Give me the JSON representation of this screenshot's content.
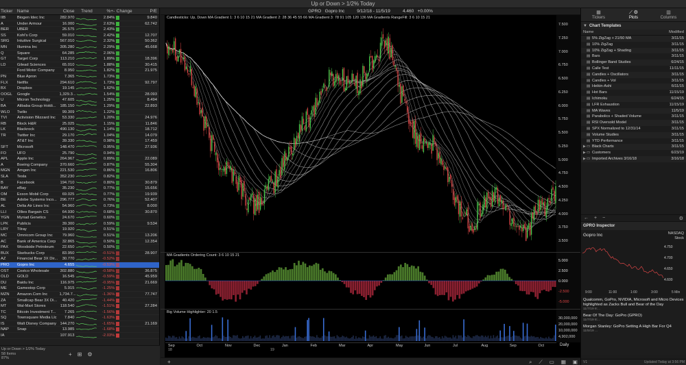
{
  "window": {
    "title": "Up or Down > 1/2% Today"
  },
  "watchlist": {
    "columns": {
      "ticker": "Ticker",
      "name": "Name",
      "close": "Close",
      "trend": "Trend",
      "pct": "%+-",
      "change": "Change",
      "pe": "P/E"
    },
    "rows": [
      {
        "ticker": "IIB",
        "name": "Biogen Idec Inc",
        "close": "282.970",
        "pct": "2.84%",
        "pe": "9.840",
        "dir": "up",
        "mag": 0.9
      },
      {
        "ticker": "A",
        "name": "Under Armour",
        "close": "16.000",
        "pct": "2.63%",
        "pe": "62.742",
        "dir": "up",
        "mag": 0.85
      },
      {
        "ticker": "BER",
        "name": "UBER",
        "close": "26.575",
        "pct": "2.43%",
        "pe": "",
        "dir": "up",
        "mag": 0.8
      },
      {
        "ticker": "SS",
        "name": "Kohl's Corp",
        "close": "59.010",
        "pct": "2.42%",
        "pe": "12.707",
        "dir": "up",
        "mag": 0.8
      },
      {
        "ticker": "SRG",
        "name": "Intuitive Surgical",
        "close": "567.010",
        "pct": "2.32%",
        "pe": "50.362",
        "dir": "up",
        "mag": 0.75
      },
      {
        "ticker": "MN",
        "name": "Illumina Inc",
        "close": "305.280",
        "pct": "2.29%",
        "pe": "45.668",
        "dir": "up",
        "mag": 0.75
      },
      {
        "ticker": "Q",
        "name": "Square",
        "close": "64.285",
        "pct": "2.06%",
        "pe": "",
        "dir": "up",
        "mag": 0.7
      },
      {
        "ticker": "GT",
        "name": "Target Corp",
        "close": "113.210",
        "pct": "1.89%",
        "pe": "18.396",
        "dir": "up",
        "mag": 0.65
      },
      {
        "ticker": "LD",
        "name": "Gilead Sciences",
        "close": "65.010",
        "pct": "1.88%",
        "pe": "30.415",
        "dir": "up",
        "mag": 0.65
      },
      {
        "ticker": "",
        "name": "Ford Motor Company",
        "close": "8.950",
        "pct": "1.82%",
        "pe": "21.975",
        "dir": "up",
        "mag": 0.6
      },
      {
        "ticker": "PN",
        "name": "Blue Apron",
        "close": "7.365",
        "pct": "1.73%",
        "pe": "",
        "dir": "up",
        "mag": 0.6
      },
      {
        "ticker": "FLX",
        "name": "Netflix",
        "close": "294.610",
        "pct": "1.73%",
        "pe": "92.797",
        "dir": "up",
        "mag": 0.6
      },
      {
        "ticker": "BX",
        "name": "Dropbox",
        "close": "19.145",
        "pct": "1.62%",
        "pe": "",
        "dir": "up",
        "mag": 0.55
      },
      {
        "ticker": "OOGL",
        "name": "Google",
        "close": "1,329.3...",
        "pct": "1.54%",
        "pe": "28.093",
        "dir": "up",
        "mag": 0.55
      },
      {
        "ticker": "U",
        "name": "Micron Technology",
        "close": "47.605",
        "pct": "1.25%",
        "pe": "8.494",
        "dir": "up",
        "mag": 0.45
      },
      {
        "ticker": "BA",
        "name": "Alibaba Group Holdi...",
        "close": "185.150",
        "pct": "1.29%",
        "pe": "22.893",
        "dir": "up",
        "mag": 0.45
      },
      {
        "ticker": "WLO",
        "name": "Twilio",
        "close": "99.309",
        "pct": "1.22%",
        "pe": "",
        "dir": "up",
        "mag": 0.45
      },
      {
        "ticker": "TVI",
        "name": "Activision Blizzard Inc",
        "close": "53.330",
        "pct": "1.20%",
        "pe": "24.976",
        "dir": "up",
        "mag": 0.4
      },
      {
        "ticker": "RB",
        "name": "Block H&R",
        "close": "25.025",
        "pct": "1.15%",
        "pe": "11.846",
        "dir": "up",
        "mag": 0.4
      },
      {
        "ticker": "LK",
        "name": "Blackrock",
        "close": "490.130",
        "pct": "1.14%",
        "pe": "18.712",
        "dir": "up",
        "mag": 0.4
      },
      {
        "ticker": "TR",
        "name": "Twitter Inc",
        "close": "29.170",
        "pct": "1.04%",
        "pe": "14.079",
        "dir": "up",
        "mag": 0.35
      },
      {
        "ticker": "",
        "name": "AT&T Inc",
        "close": "39.330",
        "pct": "0.98%",
        "pe": "17.459",
        "dir": "up",
        "mag": 0.35
      },
      {
        "ticker": "SFT",
        "name": "Microsoft",
        "close": "148.470",
        "pct": "0.95%",
        "pe": "27.936",
        "dir": "up",
        "mag": 0.3
      },
      {
        "ticker": "FO",
        "name": "UFO",
        "close": "25.790",
        "pct": "0.94%",
        "pe": "",
        "dir": "up",
        "mag": 0.3
      },
      {
        "ticker": "APL",
        "name": "Apple Inc",
        "close": "264.967",
        "pct": "0.89%",
        "pe": "22.089",
        "dir": "up",
        "mag": 0.3
      },
      {
        "ticker": "A",
        "name": "Boeing Company",
        "close": "370.660",
        "pct": "0.87%",
        "pe": "55.304",
        "dir": "up",
        "mag": 0.3
      },
      {
        "ticker": "MGN",
        "name": "Amgen Inc",
        "close": "221.530",
        "pct": "0.86%",
        "pe": "16.806",
        "dir": "up",
        "mag": 0.3
      },
      {
        "ticker": "SLA",
        "name": "Tesla",
        "close": "352.230",
        "pct": "0.82%",
        "pe": "",
        "dir": "up",
        "mag": 0.3
      },
      {
        "ticker": "B",
        "name": "Facebook",
        "close": "194.710",
        "pct": "0.80%",
        "pe": "30.879",
        "dir": "up",
        "mag": 0.3
      },
      {
        "ticker": "BAY",
        "name": "eBay",
        "close": "35.230",
        "pct": "0.77%",
        "pe": "15.656",
        "dir": "up",
        "mag": 0.25
      },
      {
        "ticker": "OM",
        "name": "Exxon Mobil Corp",
        "close": "69.025",
        "pct": "0.77%",
        "pe": "19.939",
        "dir": "up",
        "mag": 0.25
      },
      {
        "ticker": "BE",
        "name": "Adobe Systems Inco...",
        "close": "296.777",
        "pct": "0.76%",
        "pe": "52.407",
        "dir": "up",
        "mag": 0.25
      },
      {
        "ticker": "AL",
        "name": "Delta Air Lines Inc",
        "close": "54.960",
        "pct": "0.73%",
        "pe": "8.000",
        "dir": "up",
        "mag": 0.25
      },
      {
        "ticker": "LLI",
        "name": "Ollies Bargain CS",
        "close": "64.930",
        "pct": "0.68%",
        "pe": "30.870",
        "dir": "up",
        "mag": 0.2
      },
      {
        "ticker": "YGN",
        "name": "Myriad Genetics",
        "close": "24.670",
        "pct": "0.60%",
        "pe": "",
        "dir": "up",
        "mag": 0.2
      },
      {
        "ticker": "LPK",
        "name": "Publicis",
        "close": "39.300",
        "pct": "0.59%",
        "pe": "9.534",
        "dir": "up",
        "mag": 0.2
      },
      {
        "ticker": "LRY",
        "name": "Tilray",
        "close": "19.920",
        "pct": "0.51%",
        "pe": "",
        "dir": "up",
        "mag": 0.2
      },
      {
        "ticker": "MC",
        "name": "Omnicom Group Inc",
        "close": "79.960",
        "pct": "0.51%",
        "pe": "13.206",
        "dir": "up",
        "mag": 0.2
      },
      {
        "ticker": "AC",
        "name": "Bank of America Corp",
        "close": "32.865",
        "pct": "0.50%",
        "pe": "12.354",
        "dir": "up",
        "mag": 0.2
      },
      {
        "ticker": "PAX",
        "name": "Woodside Petroleum",
        "close": "22.650",
        "pct": "0.50%",
        "pe": "",
        "dir": "up",
        "mag": 0.2
      },
      {
        "ticker": "BUX",
        "name": "Starbucks Corp",
        "close": "83.950",
        "pct": "-0.51%",
        "pe": "28.907",
        "dir": "down",
        "mag": 0.2
      },
      {
        "ticker": "AZ",
        "name": "Financial Bear 3X Dir...",
        "close": "30.770",
        "pct": "-0.52%",
        "pe": "",
        "dir": "down",
        "mag": 0.2
      },
      {
        "ticker": "PRO",
        "name": "Gopro Inc",
        "close": "4.655",
        "pct": "-0.53%",
        "pe": "",
        "dir": "down",
        "mag": 0.2,
        "selected": true
      },
      {
        "ticker": "OST",
        "name": "Costco Wholesale",
        "close": "302.880",
        "pct": "-0.58%",
        "pe": "36.875",
        "dir": "down",
        "mag": 0.2
      },
      {
        "ticker": "OLD",
        "name": "GOLD",
        "close": "16.545",
        "pct": "-0.59%",
        "pe": "45.959",
        "dir": "down",
        "mag": 0.2
      },
      {
        "ticker": "DU",
        "name": "Baidu Inc",
        "close": "116.975",
        "pct": "-0.95%",
        "pe": "21.669",
        "dir": "down",
        "mag": 0.3
      },
      {
        "ticker": "ME",
        "name": "Gamestop Corp",
        "close": "5.915",
        "pct": "-1.25%",
        "pe": "",
        "dir": "down",
        "mag": 0.45
      },
      {
        "ticker": "MZN",
        "name": "Amazon.Com Inc",
        "close": "1,734.7...",
        "pct": "-1.36%",
        "pe": "77.747",
        "dir": "down",
        "mag": 0.5
      },
      {
        "ticker": "ZA",
        "name": "Smallcap Bear 3X Di...",
        "close": "40.420",
        "pct": "-1.44%",
        "pe": "",
        "dir": "down",
        "mag": 0.5
      },
      {
        "ticker": "MT",
        "name": "Wal-Mart Stores",
        "close": "118.540",
        "pct": "-1.51%",
        "pe": "27.284",
        "dir": "down",
        "mag": 0.55
      },
      {
        "ticker": "TC",
        "name": "Bitcoin Investment T...",
        "close": "7.265",
        "pct": "-1.56%",
        "pe": "",
        "dir": "down",
        "mag": 0.55
      },
      {
        "ticker": "SQ",
        "name": "Townsquare Media Llc",
        "close": "7.840",
        "pct": "-1.63%",
        "pe": "",
        "dir": "down",
        "mag": 0.6
      },
      {
        "ticker": "IS",
        "name": "Walt Disney Company",
        "close": "144.270",
        "pct": "-1.65%",
        "pe": "21.169",
        "dir": "down",
        "mag": 0.6
      },
      {
        "ticker": "NAP",
        "name": "Snap",
        "close": "13.985",
        "pct": "-1.68%",
        "pe": "",
        "dir": "down",
        "mag": 0.6
      },
      {
        "ticker": "IA",
        "name": "",
        "close": "107.913",
        "pct": "-2.03%",
        "pe": "",
        "dir": "down",
        "mag": 0.7
      }
    ],
    "footer": {
      "line1": "Up or Down > 1/2% Today",
      "line2": "58 Items",
      "line3": "87%"
    }
  },
  "chart": {
    "header": "GPRO   Gopro Inc          9/12/18 - 11/5/19          4.460   +0.00%",
    "price_pane_label": "Candlesticks: Up, Down    MA Gradient 1: 3 6 10 15 21    MA Gradient 2: 28 36 45 55 66    MA Gradient 3: 78 91 105 120 136    MA Gradients RangeFill: 3 6 10 15 21",
    "ordering_label": "MA Gradients Ordering Count:  3 6 10 15 21",
    "volume_label": "Big Volume Highlighter:  20 1.5",
    "period": "Daily",
    "x_months": [
      "Sep",
      "Oct",
      "Nov",
      "Dec",
      "Jan",
      "Feb",
      "Mar",
      "Apr",
      "May",
      "Jun",
      "Jul",
      "Aug",
      "Sep",
      "Oct"
    ],
    "x_years": [
      "18",
      "19"
    ],
    "price_ticks": [
      "7.500",
      "7.250",
      "7.000",
      "6.750",
      "6.500",
      "6.250",
      "6.000",
      "5.750",
      "5.500",
      "5.250",
      "5.000",
      "4.750",
      "4.500",
      "4.250",
      "4.000",
      "3.750",
      "3.500"
    ],
    "right_values": [
      "5.082",
      "4.913",
      "4.736",
      "4.596",
      "4.488",
      "4.162",
      "3.871",
      "3.676"
    ],
    "ordering_ticks": [
      "5.000",
      "2.500",
      "0.000",
      "-2.500",
      "-5.000"
    ],
    "ordering_right": [
      "-1.000"
    ],
    "volume_ticks": [
      "30,000,000",
      "20,000,000",
      "10,000,000",
      "4,902,000"
    ]
  },
  "chart_data": {
    "type": "candlestick",
    "title": "GPRO Gopro Inc",
    "x_range": [
      "9/12/18",
      "11/5/19"
    ],
    "ylim": [
      3.5,
      7.5
    ],
    "last": 4.46,
    "change_pct": 0.0,
    "approx_close_path": [
      {
        "month": "Sep 18",
        "close": 7.2
      },
      {
        "month": "Oct 18",
        "close": 6.4
      },
      {
        "month": "Nov 18",
        "close": 4.8
      },
      {
        "month": "Dec 18",
        "close": 4.3
      },
      {
        "month": "Jan 19",
        "close": 4.5
      },
      {
        "month": "Feb 19",
        "close": 5.9
      },
      {
        "month": "Mar 19",
        "close": 6.4
      },
      {
        "month": "Apr 19",
        "close": 6.6
      },
      {
        "month": "May 19",
        "close": 7.0
      },
      {
        "month": "Jun 19",
        "close": 5.5
      },
      {
        "month": "Jul 19",
        "close": 4.8
      },
      {
        "month": "Aug 19",
        "close": 3.8
      },
      {
        "month": "Sep 19",
        "close": 4.4
      },
      {
        "month": "Oct 19",
        "close": 3.6
      },
      {
        "month": "Nov 19",
        "close": 4.46
      }
    ]
  },
  "right_panel": {
    "tabs": [
      {
        "label": "Tickers",
        "icon": "grid-icon"
      },
      {
        "label": "Plots",
        "icon": "plots-icon",
        "active": true
      },
      {
        "label": "Columns",
        "icon": "columns-icon"
      }
    ],
    "section": "Chart Templates",
    "col_name": "Name",
    "col_modified": "Modified",
    "templates": [
      {
        "name": "5% ZigZag + 21/50 MA",
        "date": "3/11/15"
      },
      {
        "name": "10% ZigZag",
        "date": "3/11/15"
      },
      {
        "name": "10% ZigZag + Shading",
        "date": "3/11/15"
      },
      {
        "name": "Bars",
        "date": "3/11/15"
      },
      {
        "name": "Bollinger Band Studies",
        "date": "6/24/15"
      },
      {
        "name": "Calle Test",
        "date": "11/11/15"
      },
      {
        "name": "Candles + Oscillators",
        "date": "3/11/15"
      },
      {
        "name": "Candles + Vol",
        "date": "3/11/15"
      },
      {
        "name": "Heikin-Ashi",
        "date": "6/11/15"
      },
      {
        "name": "Hot Bars",
        "date": "11/15/19"
      },
      {
        "name": "Ichimoku",
        "date": "6/24/15"
      },
      {
        "name": "LFR Exhaustion",
        "date": "11/15/19"
      },
      {
        "name": "MA Waves",
        "date": "11/5/19"
      },
      {
        "name": "Parabolics + Shaded Volume",
        "date": "3/11/15"
      },
      {
        "name": "RSI Oversold Model",
        "date": "3/11/15"
      },
      {
        "name": "SPX Normalized to 12/31/14",
        "date": "3/11/15"
      },
      {
        "name": "Volume Studies",
        "date": "3/11/15"
      },
      {
        "name": "YTD Performance",
        "date": "3/11/15"
      },
      {
        "name": "Black Charts",
        "date": "3/11/15",
        "folder": true
      },
      {
        "name": "Customers",
        "date": "6/23/19",
        "folder": true
      },
      {
        "name": "Imported Archives 3/16/18",
        "date": "3/16/18",
        "folder": true
      }
    ],
    "inspector": {
      "title": "GPRO Inspector",
      "name": "Gopro Inc",
      "exchange": "NASDAQ",
      "kind": "Stock",
      "y_ticks": [
        "4.750",
        "4.700",
        "4.650",
        "4.600"
      ],
      "x_ticks": [
        "9:00",
        "11:00",
        "1:00",
        "3:00"
      ],
      "interval": "5 Min"
    },
    "news": [
      {
        "headline": "Qualcomm, GoPro, NVIDIA, Microsoft and Micro Devices highlighted as Zacks Bull and Bear of the Day",
        "meta": "11/7/19 8:..."
      },
      {
        "headline": "Bear Of The Day: GoPro (GPRO)",
        "meta": "11/7/19 8:..."
      },
      {
        "headline": "Morgan Stanley: GoPro Setting A High Bar For Q4",
        "meta": "11/5/19 ..."
      }
    ],
    "status": "Updated Today at 3:56 PM",
    "version": "V1"
  }
}
